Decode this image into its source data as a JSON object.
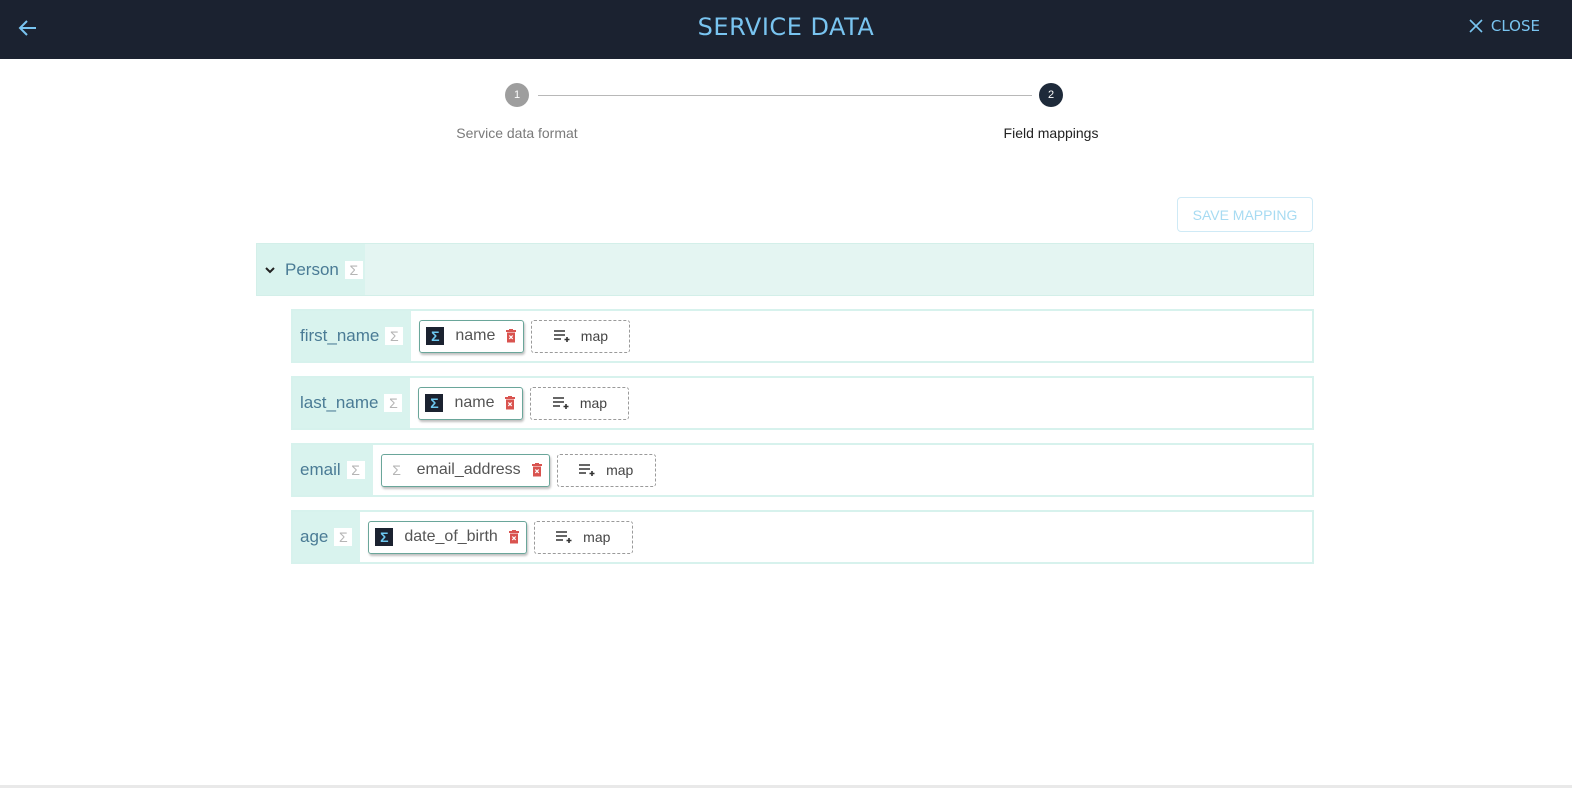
{
  "header": {
    "title": "SERVICE DATA",
    "close_label": "CLOSE",
    "back_icon": "arrow-left-icon",
    "close_icon": "close-x-icon"
  },
  "stepper": {
    "steps": [
      {
        "number": "1",
        "label": "Service data format",
        "state": "inactive"
      },
      {
        "number": "2",
        "label": "Field mappings",
        "state": "active"
      }
    ]
  },
  "toolbar": {
    "save_label": "SAVE MAPPING"
  },
  "mapping": {
    "parent": {
      "name": "Person",
      "type_symbol": "Σ"
    },
    "fields": [
      {
        "name": "first_name",
        "type_symbol": "Σ",
        "mapped": {
          "name": "name",
          "symbol": "Σ",
          "style": "dark"
        },
        "map_label": "map"
      },
      {
        "name": "last_name",
        "type_symbol": "Σ",
        "mapped": {
          "name": "name",
          "symbol": "Σ",
          "style": "dark"
        },
        "map_label": "map"
      },
      {
        "name": "email",
        "type_symbol": "Σ",
        "mapped": {
          "name": "email_address",
          "symbol": "Σ",
          "style": "light"
        },
        "map_label": "map"
      },
      {
        "name": "age",
        "type_symbol": "Σ",
        "mapped": {
          "name": "date_of_birth",
          "symbol": "Σ",
          "style": "dark"
        },
        "map_label": "map"
      }
    ]
  },
  "colors": {
    "header_bg": "#1b2230",
    "accent": "#79c4f0",
    "row_bg": "#d9f3ee",
    "delete": "#d9534f"
  }
}
